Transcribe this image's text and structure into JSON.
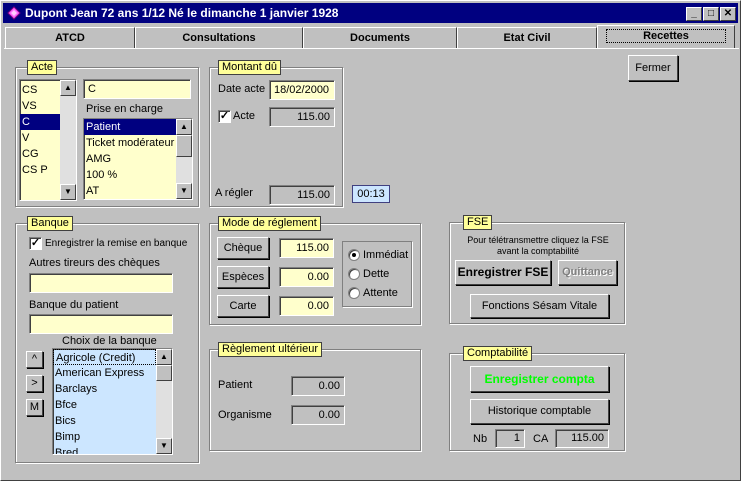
{
  "window": {
    "title": "Dupont Jean  72 ans  1/12 Né le dimanche 1 janvier 1928",
    "controls": {
      "minimize": "_",
      "maximize": "□",
      "close": "✕"
    }
  },
  "tabs": [
    "ATCD",
    "Consultations",
    "Documents",
    "Etat Civil",
    "Recettes"
  ],
  "close_button": "Fermer",
  "acte": {
    "legend": "Acte",
    "codes": [
      "CS",
      "VS",
      "C",
      "V",
      "CG",
      "CS P"
    ],
    "selected_code": "C",
    "code_field": "C",
    "prise_label": "Prise en charge",
    "prise_items": [
      "Patient",
      "Ticket modérateur",
      "AMG",
      "100 %",
      "AT"
    ]
  },
  "montant": {
    "legend": "Montant dû",
    "date_label": "Date acte",
    "date_value": "18/02/2000",
    "acte_label": "Acte",
    "acte_value": "115.00",
    "regler_label": "A régler",
    "regler_value": "115.00",
    "timer": "00:13"
  },
  "banque": {
    "legend": "Banque",
    "remise_label": "Enregistrer la remise en banque",
    "tireurs_label": "Autres tireurs des chèques",
    "tireurs_value": "",
    "patient_label": "Banque du patient",
    "patient_value": "",
    "choix_label": "Choix de la banque",
    "side_buttons": [
      "^",
      ">",
      "M"
    ],
    "banks": [
      "Agricole (Credit)",
      "American Express",
      "Barclays",
      "Bfce",
      "Bics",
      "Bimp",
      "Bred"
    ]
  },
  "mode": {
    "legend": "Mode de réglement",
    "cheque_label": "Chèque",
    "cheque_value": "115.00",
    "especes_label": "Espèces",
    "especes_value": "0.00",
    "carte_label": "Carte",
    "carte_value": "0.00",
    "radio_immediat": "Immédiat",
    "radio_dette": "Dette",
    "radio_attente": "Attente"
  },
  "ulterieur": {
    "legend": "Règlement ultérieur",
    "patient_label": "Patient",
    "patient_value": "0.00",
    "organisme_label": "Organisme",
    "organisme_value": "0.00"
  },
  "fse": {
    "legend": "FSE",
    "info_line1": "Pour télétransmettre cliquez la FSE",
    "info_line2": "avant la comptabilité",
    "enregistrer": "Enregistrer FSE",
    "quittance": "Quittance",
    "sesam": "Fonctions Sésam Vitale"
  },
  "compta": {
    "legend": "Comptabilité",
    "enregistrer": "Enregistrer compta",
    "historique": "Historique comptable",
    "nb_label": "Nb",
    "nb_value": "1",
    "ca_label": "CA",
    "ca_value": "115.00",
    "green": "#00ff00"
  }
}
